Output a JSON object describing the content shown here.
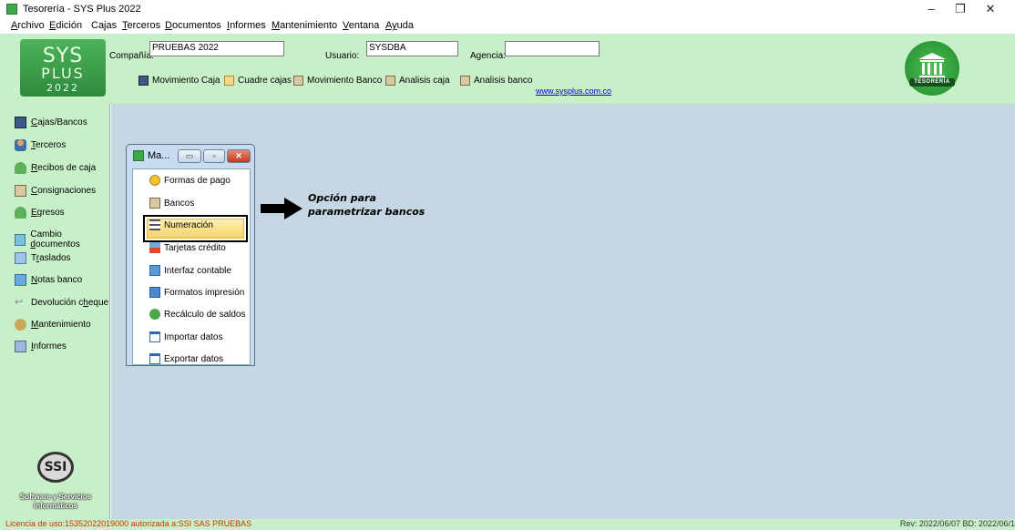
{
  "window": {
    "title": "Tesorería - SYS Plus 2022",
    "controls": [
      "–",
      "❐",
      "✕"
    ]
  },
  "menu": {
    "items": [
      {
        "key": "A",
        "rest": "rchivo"
      },
      {
        "key": "E",
        "rest": "dición"
      },
      {
        "key": "",
        "rest": "Cajas"
      },
      {
        "key": "T",
        "rest": "erceros"
      },
      {
        "key": "D",
        "rest": "ocumentos"
      },
      {
        "key": "I",
        "rest": "nformes"
      },
      {
        "key": "M",
        "rest": "antenimiento"
      },
      {
        "key": "V",
        "rest": "entana"
      },
      {
        "key": "Ay",
        "rest": "uda"
      }
    ]
  },
  "logo": {
    "line1": "SYS",
    "line2": "PLUS",
    "line3": "2022"
  },
  "header": {
    "company_label": "Compañía:",
    "company_value": "PRUEBAS 2022",
    "user_label": "Usuario:",
    "user_value": "SYSDBA",
    "agency_label": "Agencia:",
    "agency_value": "",
    "link": "www.sysplus.com.co",
    "badge": "TESORERÍA"
  },
  "toolbar": {
    "buttons": [
      {
        "label": "Movimiento Caja",
        "icon": "cash-register-icon"
      },
      {
        "label": "Cuadre cajas",
        "icon": "clipboard-icon"
      },
      {
        "label": "Movimiento Banco",
        "icon": "bank-icon"
      },
      {
        "label": "Analisis caja",
        "icon": "bank-icon"
      },
      {
        "label": "Analisis banco",
        "icon": "bank-icon"
      }
    ]
  },
  "sidebar": {
    "items": [
      {
        "key": "C",
        "rest": "ajas/Bancos",
        "prefix": "",
        "icon": "cash-register-icon"
      },
      {
        "key": "T",
        "rest": "erceros",
        "prefix": "",
        "icon": "person-icon"
      },
      {
        "key": "R",
        "rest": "ecibos de caja",
        "prefix": "",
        "icon": "money-icon"
      },
      {
        "key": "C",
        "rest": "onsignaciones",
        "prefix": "",
        "icon": "bank-icon"
      },
      {
        "key": "E",
        "rest": "gresos",
        "prefix": "",
        "icon": "money-icon"
      },
      {
        "key": "d",
        "rest": "ocumentos",
        "prefix": "Cambio ",
        "icon": "exchange-icon"
      },
      {
        "key": "r",
        "rest": "aslados",
        "prefix": "T",
        "icon": "transfer-icon"
      },
      {
        "key": "N",
        "rest": "otas banco",
        "prefix": "",
        "icon": "notes-icon"
      },
      {
        "key": "h",
        "rest": "eque",
        "prefix": "Devolución c",
        "icon": "return-icon"
      },
      {
        "key": "M",
        "rest": "antenimiento",
        "prefix": "",
        "icon": "wrench-icon"
      },
      {
        "key": "I",
        "rest": "nformes",
        "prefix": "",
        "icon": "printer-icon"
      }
    ],
    "ssi": {
      "mark": "SSI",
      "line1": "Software y Servicios",
      "line2": "Informáticos"
    }
  },
  "child_window": {
    "title": "Ma...",
    "controls": [
      "▭",
      "▫",
      "✕"
    ],
    "items": [
      {
        "label": "Formas de pago",
        "icon": "coins-icon"
      },
      {
        "label": "Bancos",
        "icon": "bank-icon",
        "selected": true
      },
      {
        "label": "Numeración",
        "icon": "list-icon"
      },
      {
        "label": "Tarjetas crédito",
        "icon": "credit-card-icon"
      },
      {
        "label": "Interfaz contable",
        "icon": "interface-icon"
      },
      {
        "label": "Formatos impresión",
        "icon": "print-format-icon"
      },
      {
        "label": "Recálculo de saldos",
        "icon": "recalc-icon"
      },
      {
        "label": "Importar datos",
        "icon": "import-icon"
      },
      {
        "label": "Exportar datos",
        "icon": "export-icon"
      }
    ]
  },
  "annotation": {
    "line1": "Opción para",
    "line2": "parametrizar bancos"
  },
  "status": {
    "license": "Licencia de uso:15352022019000 autorizada a:SSI SAS PRUEBAS",
    "revision": "Rev: 2022/06/07 BD: 2022/06/1"
  },
  "colors": {
    "panel_green": "#c8f0c8",
    "mdi_bg": "#c4d7e3",
    "accent_green": "#2e8a3d",
    "license_red": "#d03000"
  }
}
